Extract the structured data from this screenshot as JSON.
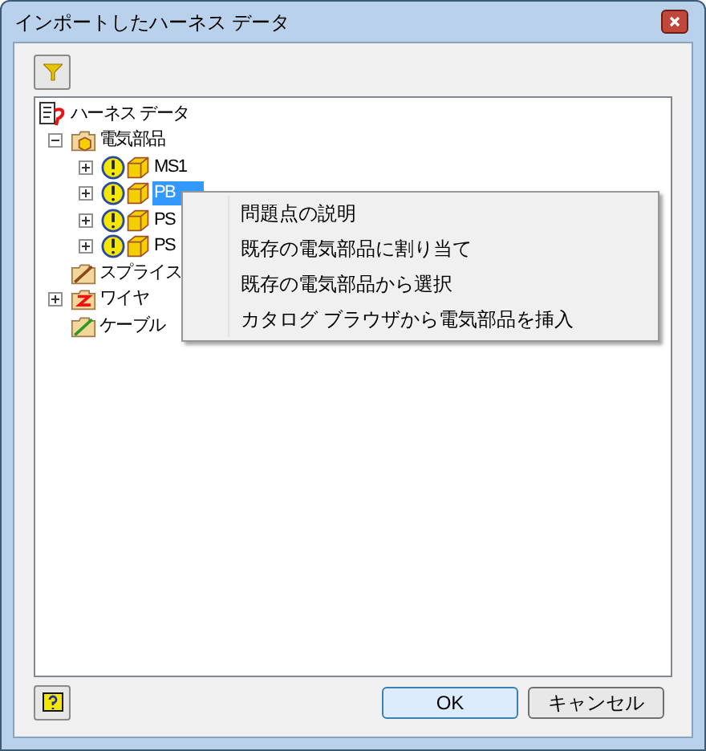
{
  "window": {
    "title": "インポートしたハーネス データ"
  },
  "tree": [
    {
      "label": "ハーネス データ",
      "kind": "harness",
      "children": [
        {
          "label": "電気部品",
          "kind": "folder-component",
          "expanded": true,
          "children": [
            {
              "label": "MS1",
              "kind": "component",
              "warning": true,
              "expanded": false,
              "selected": false
            },
            {
              "label": "PB",
              "kind": "component",
              "warning": true,
              "expanded": false,
              "selected": true
            },
            {
              "label": "PS",
              "kind": "component",
              "warning": true,
              "expanded": false,
              "selected": false
            },
            {
              "label": "PS",
              "kind": "component",
              "warning": true,
              "expanded": false,
              "selected": false
            }
          ]
        },
        {
          "label": "スプライス",
          "kind": "folder-splice"
        },
        {
          "label": "ワイヤ",
          "kind": "folder-wire",
          "expanded": false
        },
        {
          "label": "ケーブル",
          "kind": "folder-cable"
        }
      ]
    }
  ],
  "context_menu": [
    "問題点の説明",
    "既存の電気部品に割り当て",
    "既存の電気部品から選択",
    "カタログ ブラウザから電気部品を挿入"
  ],
  "buttons": {
    "ok": "OK",
    "cancel": "キャンセル"
  }
}
